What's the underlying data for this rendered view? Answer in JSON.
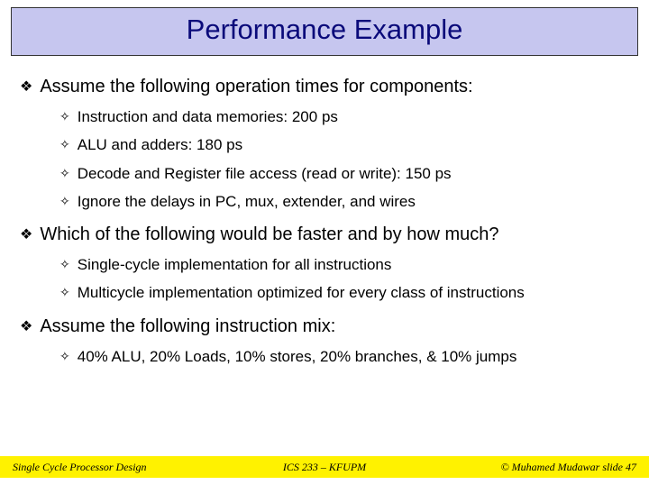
{
  "title": "Performance Example",
  "bullets": [
    {
      "text": "Assume the following operation times for components:",
      "children": [
        "Instruction and data memories: 200 ps",
        "ALU and adders: 180 ps",
        "Decode and Register file access (read or write): 150 ps",
        "Ignore the delays in PC, mux, extender, and wires"
      ]
    },
    {
      "text": "Which of the following would be faster and by how much?",
      "children": [
        "Single-cycle implementation for all instructions",
        "Multicycle implementation optimized for every class of instructions"
      ]
    },
    {
      "text": "Assume the following instruction mix:",
      "children": [
        "40% ALU, 20% Loads, 10% stores, 20% branches, & 10% jumps"
      ]
    }
  ],
  "footer": {
    "left": "Single Cycle Processor Design",
    "center": "ICS 233 – KFUPM",
    "right": "© Muhamed Mudawar  slide 47"
  }
}
